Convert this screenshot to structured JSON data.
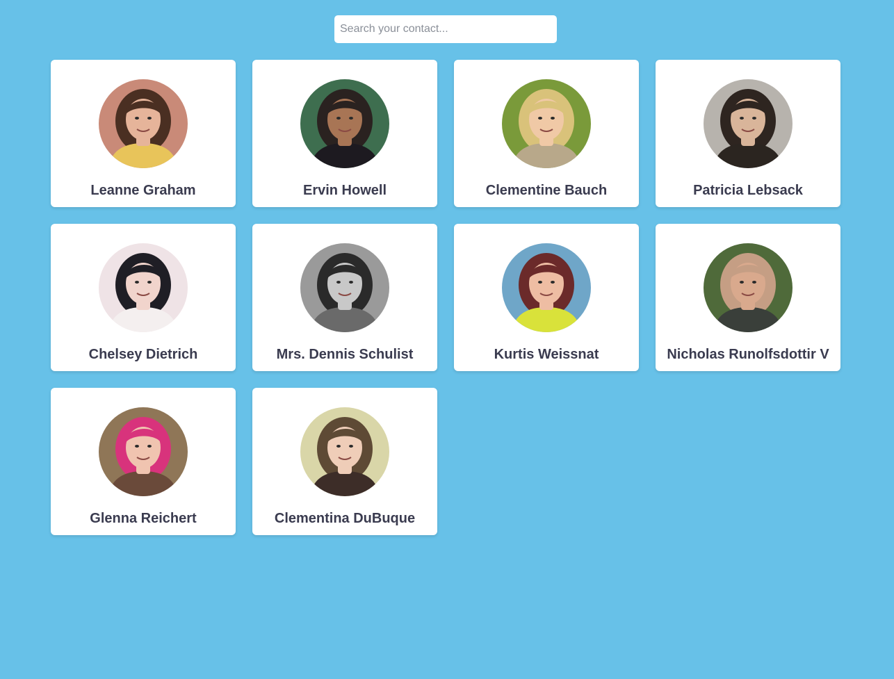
{
  "search": {
    "placeholder": "Search your contact...",
    "value": ""
  },
  "contacts": [
    {
      "name": "Leanne Graham",
      "bg": "#c98a78",
      "hair": "#4a2f22",
      "skin": "#e6b49a",
      "shirt": "#e8c45a"
    },
    {
      "name": "Ervin Howell",
      "bg": "#3e6e4f",
      "hair": "#2a2220",
      "skin": "#a87555",
      "shirt": "#1d1a20"
    },
    {
      "name": "Clementine Bauch",
      "bg": "#7a9a3a",
      "hair": "#d9c27a",
      "skin": "#f0c9a6",
      "shirt": "#b8a88a"
    },
    {
      "name": "Patricia Lebsack",
      "bg": "#b7b3ad",
      "hair": "#2e2520",
      "skin": "#d9b59a",
      "shirt": "#2b2520"
    },
    {
      "name": "Chelsey Dietrich",
      "bg": "#efe3e6",
      "hair": "#1f1e25",
      "skin": "#f1d4cc",
      "shirt": "#f4efef"
    },
    {
      "name": "Mrs. Dennis Schulist",
      "bg": "#9a9a9a",
      "hair": "#2a2a2a",
      "skin": "#c8c8c8",
      "shirt": "#6a6a6a"
    },
    {
      "name": "Kurtis Weissnat",
      "bg": "#6fa6c8",
      "hair": "#6b2a2a",
      "skin": "#eebda3",
      "shirt": "#d9e23a"
    },
    {
      "name": "Nicholas Runolfsdottir V",
      "bg": "#4f6a3a",
      "hair": "#c59e84",
      "skin": "#d9a98d",
      "shirt": "#3a3f3a"
    },
    {
      "name": "Glenna Reichert",
      "bg": "#8f7657",
      "hair": "#d8337c",
      "skin": "#f0c4b0",
      "shirt": "#6a4a3a"
    },
    {
      "name": "Clementina DuBuque",
      "bg": "#d9d6a8",
      "hair": "#5e4a35",
      "skin": "#efcdb8",
      "shirt": "#3d2d28"
    }
  ]
}
